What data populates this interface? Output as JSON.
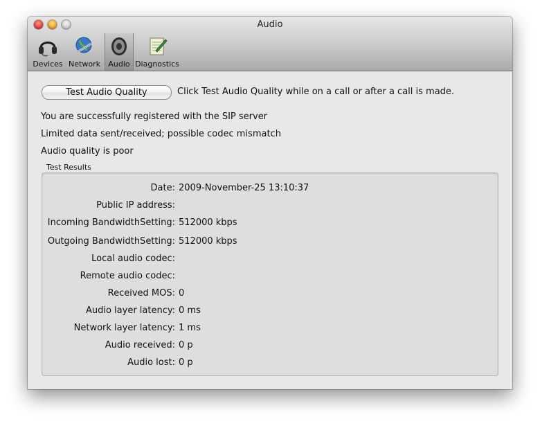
{
  "window": {
    "title": "Audio"
  },
  "toolbar": {
    "items": [
      {
        "label": "Devices",
        "icon": "headset-icon"
      },
      {
        "label": "Network",
        "icon": "globe-network-icon"
      },
      {
        "label": "Audio",
        "icon": "speaker-icon",
        "selected": true
      },
      {
        "label": "Diagnostics",
        "icon": "notepad-pencil-icon"
      }
    ]
  },
  "main": {
    "test_button_label": "Test Audio Quality",
    "test_hint": "Click Test Audio Quality while on a call or after a call is made.",
    "status_lines": [
      "You are successfully registered with the SIP server",
      "Limited data sent/received; possible codec mismatch",
      "Audio quality is poor"
    ],
    "results_title": "Test Results",
    "results": [
      {
        "label": "Date:",
        "value": "2009-November-25 13:10:37"
      },
      {
        "label": "Public IP address:",
        "value": ""
      },
      {
        "label": "Incoming BandwidthSetting:",
        "value": "512000 kbps"
      },
      {
        "label": "Outgoing BandwidthSetting:",
        "value": "512000 kbps"
      },
      {
        "label": "Local audio codec:",
        "value": ""
      },
      {
        "label": "Remote audio codec:",
        "value": ""
      },
      {
        "label": "Received MOS:",
        "value": "0"
      },
      {
        "label": "Audio layer latency:",
        "value": "0 ms"
      },
      {
        "label": "Network layer latency:",
        "value": "1 ms"
      },
      {
        "label": "Audio received:",
        "value": "0 p"
      },
      {
        "label": "Audio lost:",
        "value": "0 p"
      }
    ]
  }
}
